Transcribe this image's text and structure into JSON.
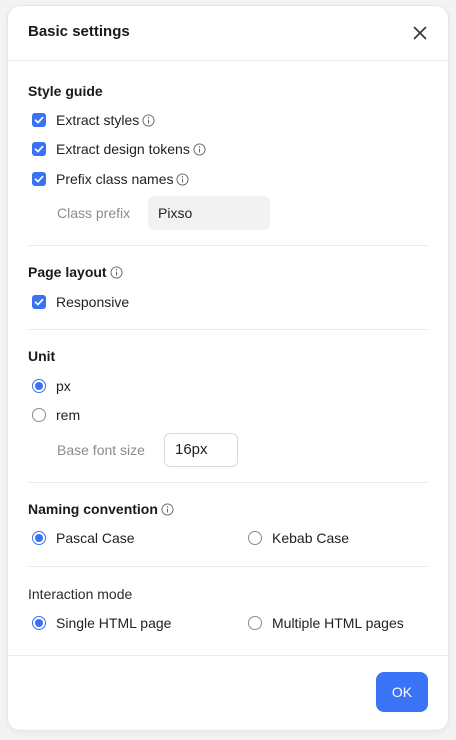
{
  "dialog": {
    "title": "Basic settings",
    "ok_label": "OK"
  },
  "style_guide": {
    "title": "Style guide",
    "extract_styles": {
      "label": "Extract styles",
      "checked": true
    },
    "extract_tokens": {
      "label": "Extract design tokens",
      "checked": true
    },
    "prefix_classes": {
      "label": "Prefix class names",
      "checked": true
    },
    "class_prefix_label": "Class prefix",
    "class_prefix_value": "Pixso"
  },
  "page_layout": {
    "title": "Page layout",
    "responsive": {
      "label": "Responsive",
      "checked": true
    }
  },
  "unit": {
    "title": "Unit",
    "options": [
      {
        "label": "px",
        "selected": true
      },
      {
        "label": "rem",
        "selected": false
      }
    ],
    "base_font_label": "Base font size",
    "base_font_value": "16px"
  },
  "naming": {
    "title": "Naming convention",
    "options": [
      {
        "label": "Pascal Case",
        "selected": true
      },
      {
        "label": "Kebab Case",
        "selected": false
      }
    ]
  },
  "interaction": {
    "title": "Interaction mode",
    "options": [
      {
        "label": "Single HTML page",
        "selected": true
      },
      {
        "label": "Multiple HTML pages",
        "selected": false
      }
    ]
  },
  "colors": {
    "accent": "#3a72f5",
    "ok_button": "#3b73f6"
  },
  "icons": [
    "close-icon",
    "info-icon",
    "check-icon"
  ]
}
